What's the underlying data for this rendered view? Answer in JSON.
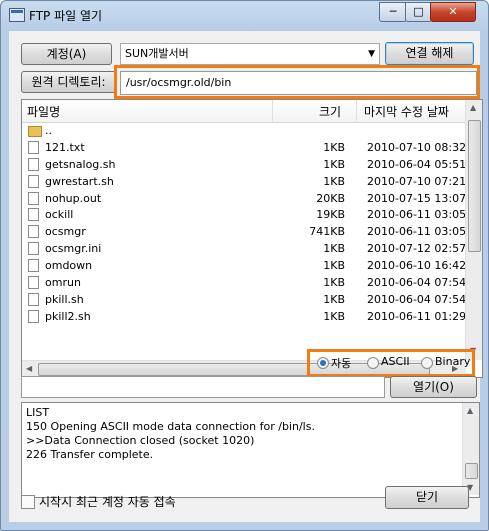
{
  "window": {
    "title": "FTP 파일 열기",
    "controls": {
      "minimize": "─",
      "maximize": "□",
      "close": "✕"
    }
  },
  "account": {
    "button_label": "계정(A)",
    "selected": "SUN개발서버",
    "disconnect_label": "연결 해제"
  },
  "remote": {
    "label": "원격 디렉토리:",
    "path": "/usr/ocsmgr.old/bin"
  },
  "file_list": {
    "columns": [
      "파일명",
      "크기",
      "마지막 수정 날짜"
    ],
    "rows": [
      {
        "name": "..",
        "size": "",
        "date": "",
        "icon": "folder-icon"
      },
      {
        "name": "121.txt",
        "size": "1KB",
        "date": "2010-07-10 08:32",
        "icon": "file-icon"
      },
      {
        "name": "getsnalog.sh",
        "size": "1KB",
        "date": "2010-06-04 05:51",
        "icon": "file-icon"
      },
      {
        "name": "gwrestart.sh",
        "size": "1KB",
        "date": "2010-07-10 07:21",
        "icon": "file-icon"
      },
      {
        "name": "nohup.out",
        "size": "20KB",
        "date": "2010-07-15 13:07",
        "icon": "file-icon"
      },
      {
        "name": "ockill",
        "size": "19KB",
        "date": "2010-06-11 03:05",
        "icon": "file-icon"
      },
      {
        "name": "ocsmgr",
        "size": "741KB",
        "date": "2010-06-11 03:05",
        "icon": "file-icon"
      },
      {
        "name": "ocsmgr.ini",
        "size": "1KB",
        "date": "2010-07-12 02:57",
        "icon": "file-icon"
      },
      {
        "name": "omdown",
        "size": "1KB",
        "date": "2010-06-10 16:42",
        "icon": "file-icon"
      },
      {
        "name": "omrun",
        "size": "1KB",
        "date": "2010-06-04 07:54",
        "icon": "file-icon"
      },
      {
        "name": "pkill.sh",
        "size": "1KB",
        "date": "2010-06-04 07:54",
        "icon": "file-icon"
      },
      {
        "name": "pkill2.sh",
        "size": "1KB",
        "date": "2010-06-11 01:29",
        "icon": "file-icon"
      }
    ]
  },
  "transfer_mode": {
    "options": [
      "자동",
      "ASCII",
      "Binary"
    ],
    "selected": "자동"
  },
  "open_button": "열기(O)",
  "log_lines": [
    "LIST",
    "150 Opening ASCII mode data connection for /bin/ls.",
    ">>Data Connection closed (socket 1020)",
    "226 Transfer complete."
  ],
  "auto_connect_label": "시작시 최근 계정 자동 접속",
  "close_button": "닫기",
  "colors": {
    "highlight": "#f07c12",
    "titlebar": "#c9dcf0"
  }
}
